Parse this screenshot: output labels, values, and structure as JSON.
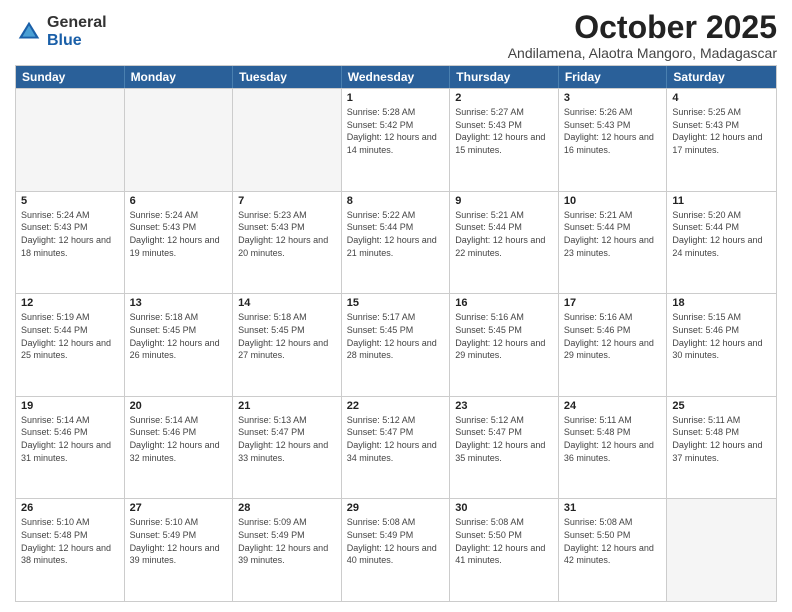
{
  "logo": {
    "general": "General",
    "blue": "Blue"
  },
  "header": {
    "month": "October 2025",
    "location": "Andilamena, Alaotra Mangoro, Madagascar"
  },
  "day_headers": [
    "Sunday",
    "Monday",
    "Tuesday",
    "Wednesday",
    "Thursday",
    "Friday",
    "Saturday"
  ],
  "weeks": [
    [
      {
        "day": "",
        "empty": true
      },
      {
        "day": "",
        "empty": true
      },
      {
        "day": "",
        "empty": true
      },
      {
        "day": "1",
        "sunrise": "Sunrise: 5:28 AM",
        "sunset": "Sunset: 5:42 PM",
        "daylight": "Daylight: 12 hours and 14 minutes."
      },
      {
        "day": "2",
        "sunrise": "Sunrise: 5:27 AM",
        "sunset": "Sunset: 5:43 PM",
        "daylight": "Daylight: 12 hours and 15 minutes."
      },
      {
        "day": "3",
        "sunrise": "Sunrise: 5:26 AM",
        "sunset": "Sunset: 5:43 PM",
        "daylight": "Daylight: 12 hours and 16 minutes."
      },
      {
        "day": "4",
        "sunrise": "Sunrise: 5:25 AM",
        "sunset": "Sunset: 5:43 PM",
        "daylight": "Daylight: 12 hours and 17 minutes."
      }
    ],
    [
      {
        "day": "5",
        "sunrise": "Sunrise: 5:24 AM",
        "sunset": "Sunset: 5:43 PM",
        "daylight": "Daylight: 12 hours and 18 minutes."
      },
      {
        "day": "6",
        "sunrise": "Sunrise: 5:24 AM",
        "sunset": "Sunset: 5:43 PM",
        "daylight": "Daylight: 12 hours and 19 minutes."
      },
      {
        "day": "7",
        "sunrise": "Sunrise: 5:23 AM",
        "sunset": "Sunset: 5:43 PM",
        "daylight": "Daylight: 12 hours and 20 minutes."
      },
      {
        "day": "8",
        "sunrise": "Sunrise: 5:22 AM",
        "sunset": "Sunset: 5:44 PM",
        "daylight": "Daylight: 12 hours and 21 minutes."
      },
      {
        "day": "9",
        "sunrise": "Sunrise: 5:21 AM",
        "sunset": "Sunset: 5:44 PM",
        "daylight": "Daylight: 12 hours and 22 minutes."
      },
      {
        "day": "10",
        "sunrise": "Sunrise: 5:21 AM",
        "sunset": "Sunset: 5:44 PM",
        "daylight": "Daylight: 12 hours and 23 minutes."
      },
      {
        "day": "11",
        "sunrise": "Sunrise: 5:20 AM",
        "sunset": "Sunset: 5:44 PM",
        "daylight": "Daylight: 12 hours and 24 minutes."
      }
    ],
    [
      {
        "day": "12",
        "sunrise": "Sunrise: 5:19 AM",
        "sunset": "Sunset: 5:44 PM",
        "daylight": "Daylight: 12 hours and 25 minutes."
      },
      {
        "day": "13",
        "sunrise": "Sunrise: 5:18 AM",
        "sunset": "Sunset: 5:45 PM",
        "daylight": "Daylight: 12 hours and 26 minutes."
      },
      {
        "day": "14",
        "sunrise": "Sunrise: 5:18 AM",
        "sunset": "Sunset: 5:45 PM",
        "daylight": "Daylight: 12 hours and 27 minutes."
      },
      {
        "day": "15",
        "sunrise": "Sunrise: 5:17 AM",
        "sunset": "Sunset: 5:45 PM",
        "daylight": "Daylight: 12 hours and 28 minutes."
      },
      {
        "day": "16",
        "sunrise": "Sunrise: 5:16 AM",
        "sunset": "Sunset: 5:45 PM",
        "daylight": "Daylight: 12 hours and 29 minutes."
      },
      {
        "day": "17",
        "sunrise": "Sunrise: 5:16 AM",
        "sunset": "Sunset: 5:46 PM",
        "daylight": "Daylight: 12 hours and 29 minutes."
      },
      {
        "day": "18",
        "sunrise": "Sunrise: 5:15 AM",
        "sunset": "Sunset: 5:46 PM",
        "daylight": "Daylight: 12 hours and 30 minutes."
      }
    ],
    [
      {
        "day": "19",
        "sunrise": "Sunrise: 5:14 AM",
        "sunset": "Sunset: 5:46 PM",
        "daylight": "Daylight: 12 hours and 31 minutes."
      },
      {
        "day": "20",
        "sunrise": "Sunrise: 5:14 AM",
        "sunset": "Sunset: 5:46 PM",
        "daylight": "Daylight: 12 hours and 32 minutes."
      },
      {
        "day": "21",
        "sunrise": "Sunrise: 5:13 AM",
        "sunset": "Sunset: 5:47 PM",
        "daylight": "Daylight: 12 hours and 33 minutes."
      },
      {
        "day": "22",
        "sunrise": "Sunrise: 5:12 AM",
        "sunset": "Sunset: 5:47 PM",
        "daylight": "Daylight: 12 hours and 34 minutes."
      },
      {
        "day": "23",
        "sunrise": "Sunrise: 5:12 AM",
        "sunset": "Sunset: 5:47 PM",
        "daylight": "Daylight: 12 hours and 35 minutes."
      },
      {
        "day": "24",
        "sunrise": "Sunrise: 5:11 AM",
        "sunset": "Sunset: 5:48 PM",
        "daylight": "Daylight: 12 hours and 36 minutes."
      },
      {
        "day": "25",
        "sunrise": "Sunrise: 5:11 AM",
        "sunset": "Sunset: 5:48 PM",
        "daylight": "Daylight: 12 hours and 37 minutes."
      }
    ],
    [
      {
        "day": "26",
        "sunrise": "Sunrise: 5:10 AM",
        "sunset": "Sunset: 5:48 PM",
        "daylight": "Daylight: 12 hours and 38 minutes."
      },
      {
        "day": "27",
        "sunrise": "Sunrise: 5:10 AM",
        "sunset": "Sunset: 5:49 PM",
        "daylight": "Daylight: 12 hours and 39 minutes."
      },
      {
        "day": "28",
        "sunrise": "Sunrise: 5:09 AM",
        "sunset": "Sunset: 5:49 PM",
        "daylight": "Daylight: 12 hours and 39 minutes."
      },
      {
        "day": "29",
        "sunrise": "Sunrise: 5:08 AM",
        "sunset": "Sunset: 5:49 PM",
        "daylight": "Daylight: 12 hours and 40 minutes."
      },
      {
        "day": "30",
        "sunrise": "Sunrise: 5:08 AM",
        "sunset": "Sunset: 5:50 PM",
        "daylight": "Daylight: 12 hours and 41 minutes."
      },
      {
        "day": "31",
        "sunrise": "Sunrise: 5:08 AM",
        "sunset": "Sunset: 5:50 PM",
        "daylight": "Daylight: 12 hours and 42 minutes."
      },
      {
        "day": "",
        "empty": true
      }
    ]
  ]
}
